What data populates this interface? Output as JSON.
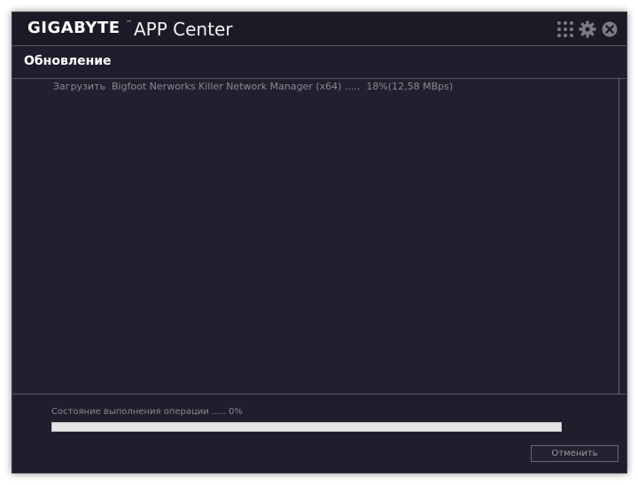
{
  "window": {
    "brand": "GIGABYTE",
    "brand_mark": "™",
    "app_name": "APP Center",
    "icons": [
      "grid-icon",
      "gear-icon",
      "close-icon"
    ]
  },
  "section": {
    "title": "Обновление"
  },
  "log": {
    "lines": [
      "Загрузить  Bigfoot Nerworks Killer Network Manager (x64) .....  18%(12,58 MBps)"
    ]
  },
  "status": {
    "text": "Состояние выполнения операции ..... 0%",
    "progress_fraction": 0
  },
  "buttons": {
    "cancel": "Отменить"
  },
  "colors": {
    "background": "#1e1e2c",
    "text_dim": "#8a8a94",
    "progress_track": "#e6e6e6"
  }
}
